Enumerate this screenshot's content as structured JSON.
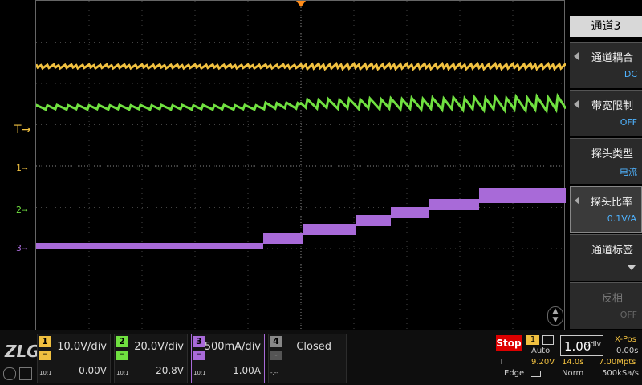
{
  "menu": {
    "title": "通道3",
    "items": [
      {
        "label": "通道耦合",
        "value": "DC"
      },
      {
        "label": "带宽限制",
        "value": "OFF"
      },
      {
        "label": "探头类型",
        "value": "电流"
      },
      {
        "label": "探头比率",
        "value": "0.1V/A"
      },
      {
        "label": "通道标签",
        "value": ""
      },
      {
        "label": "反相",
        "value": "OFF"
      }
    ]
  },
  "markers": {
    "trigger": "T",
    "ch1": "1",
    "ch2": "2",
    "ch3": "3"
  },
  "logo": "ZLG",
  "channels": [
    {
      "num": "1",
      "scale": "10.0V/div",
      "offset": "0.00V",
      "probe": "10:1",
      "color": "#f0c040"
    },
    {
      "num": "2",
      "scale": "20.0V/div",
      "offset": "-20.8V",
      "probe": "10:1",
      "color": "#70e040"
    },
    {
      "num": "3",
      "scale": "500mA/div",
      "offset": "-1.00A",
      "probe": "10:1",
      "color": "#a86ad8"
    },
    {
      "num": "4",
      "scale": "Closed",
      "offset": "--",
      "probe": "-.--",
      "color": "#888888"
    }
  ],
  "status": {
    "run_state": "Stop",
    "trigger_source": "1",
    "trigger_mode": "Auto",
    "trigger_label": "T",
    "trigger_level": "9.20V",
    "trigger_type": "Edge",
    "timebase": "1.00",
    "timebase_unit": "s/div",
    "xpos_label": "X-Pos",
    "xpos_value": "0.00s",
    "duration": "14.0s",
    "mem_depth": "7.00Mpts",
    "acq_mode": "Norm",
    "sample_rate": "500kSa/s"
  },
  "colors": {
    "ch1": "#f0c040",
    "ch2": "#70e040",
    "ch3": "#a86ad8",
    "trigger_marker": "#ff8c1a"
  }
}
